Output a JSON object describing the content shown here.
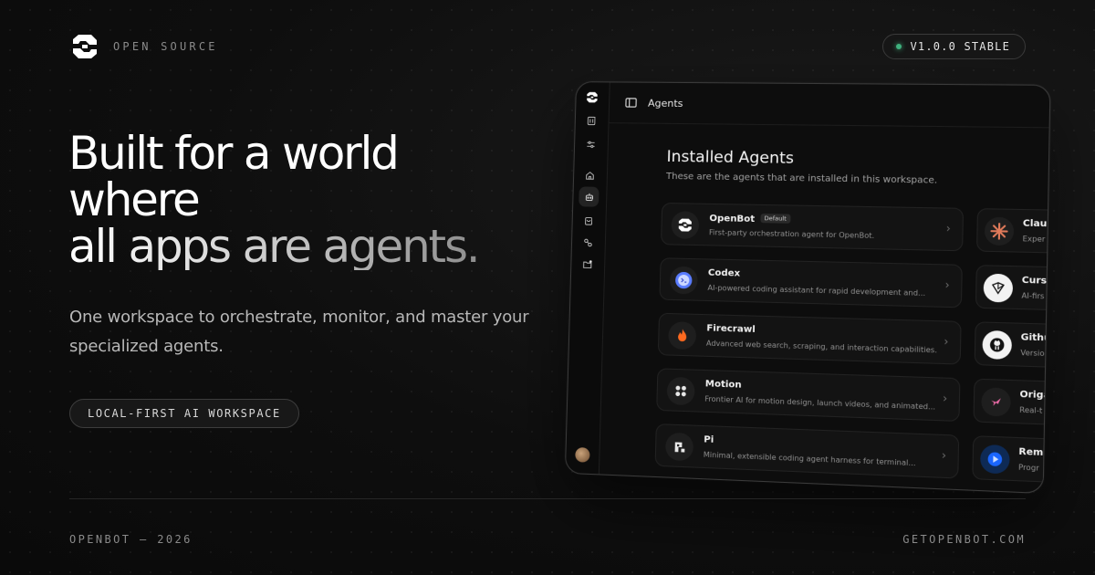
{
  "brand": {
    "logo_icon": "openbot-logo-icon",
    "label": "OPEN SOURCE"
  },
  "version_badge": {
    "label": "V1.0.0 STABLE",
    "status_color": "#3fb37f"
  },
  "hero": {
    "headline_lines": [
      "Built for a world",
      "where",
      "all apps are agents."
    ],
    "subtitle_lines": [
      "One workspace to orchestrate, monitor, and master your",
      "specialized agents."
    ],
    "pill": "LOCAL-FIRST AI WORKSPACE"
  },
  "footer": {
    "left": "OPENBOT — 2026",
    "right": "GETOPENBOT.COM"
  },
  "app": {
    "sidebar_icons": [
      "openbot-logo-icon",
      "building-icon",
      "sliders-icon",
      "home-icon",
      "bot-icon",
      "bag-icon",
      "link-icon",
      "folder-plus-icon",
      "avatar"
    ],
    "topbar": {
      "toggle_icon": "sidebar-toggle-icon",
      "title": "Agents"
    },
    "section_title": "Installed Agents",
    "section_subtitle": "These are the agents that are installed in this workspace.",
    "agents": [
      {
        "name": "OpenBot",
        "badge": "Default",
        "desc": "First-party orchestration agent for OpenBot.",
        "icon": "openbot-logo-icon"
      },
      {
        "name": "Codex",
        "badge": "",
        "desc": "AI-powered coding assistant for rapid development and...",
        "icon": "codex-icon"
      },
      {
        "name": "Firecrawl",
        "badge": "",
        "desc": "Advanced web search, scraping, and interaction capabilities.",
        "icon": "flame-icon"
      },
      {
        "name": "Motion",
        "badge": "",
        "desc": "Frontier AI for motion design, launch videos, and animated...",
        "icon": "motion-icon"
      },
      {
        "name": "Pi",
        "badge": "",
        "desc": "Minimal, extensible coding agent harness for terminal...",
        "icon": "pi-icon"
      }
    ],
    "agents_right": [
      {
        "name": "Claud",
        "desc": "Exper",
        "icon": "claude-burst-icon"
      },
      {
        "name": "Curs",
        "desc": "AI-firs",
        "icon": "cursor-icon"
      },
      {
        "name": "Githu",
        "desc": "Versio",
        "icon": "github-icon"
      },
      {
        "name": "Origa",
        "desc": "Real-t",
        "icon": "bird-icon"
      },
      {
        "name": "Remo",
        "desc": "Progr",
        "icon": "remotion-play-icon"
      }
    ],
    "chevron": "›"
  }
}
